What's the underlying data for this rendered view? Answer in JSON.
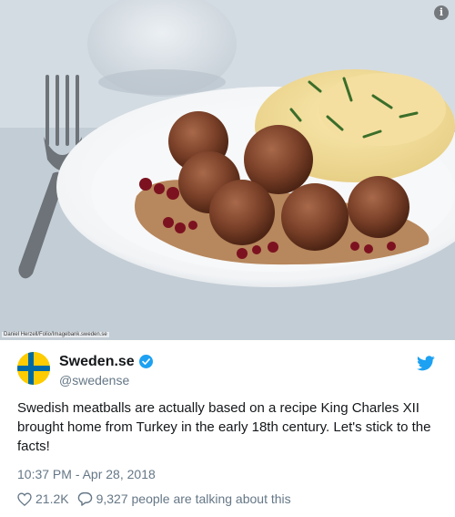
{
  "photo": {
    "credit": "Daniel Herzell/Folio/Imagebank.sweden.se",
    "info_glyph": "i"
  },
  "author": {
    "name": "Sweden.se",
    "handle": "@swedense",
    "verified": true,
    "avatar": "swedish-flag"
  },
  "tweet": {
    "text": "Swedish meatballs are actually based on a recipe King Charles XII brought home from Turkey in the early 18th century. Let's stick to the facts!",
    "timestamp": "10:37 PM - Apr 28, 2018"
  },
  "actions": {
    "likes": "21.2K",
    "talking": "9,327 people are talking about this"
  },
  "colors": {
    "text": "#14171a",
    "secondary": "#657786",
    "twitter_blue": "#1da1f2",
    "flag_blue": "#006aa7",
    "flag_yellow": "#fecc00"
  },
  "icons": [
    "info-icon",
    "verified-icon",
    "twitter-bird-icon",
    "heart-icon",
    "comment-icon"
  ]
}
